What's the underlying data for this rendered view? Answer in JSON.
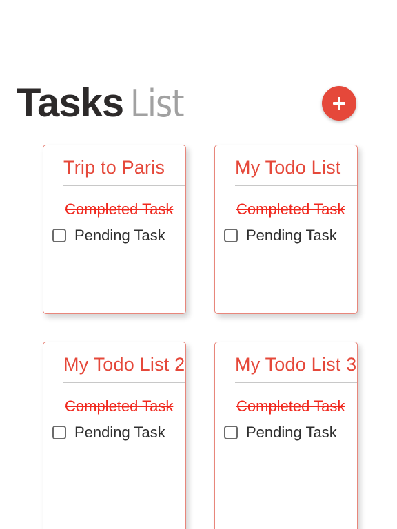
{
  "header": {
    "title_bold": "Tasks",
    "title_light": "List",
    "add_button_icon": "plus-icon"
  },
  "colors": {
    "accent": "#e5483a",
    "completed_text": "#f0281e",
    "card_border": "#e8867b"
  },
  "lists": [
    {
      "title": "Trip to Paris",
      "completed_task": "Completed Task",
      "pending_task": "Pending Task"
    },
    {
      "title": "My Todo List",
      "completed_task": "Completed Task",
      "pending_task": "Pending Task"
    },
    {
      "title": "My Todo List 2",
      "completed_task": "Completed Task",
      "pending_task": "Pending Task"
    },
    {
      "title": "My Todo List 3",
      "completed_task": "Completed Task",
      "pending_task": "Pending Task"
    }
  ]
}
